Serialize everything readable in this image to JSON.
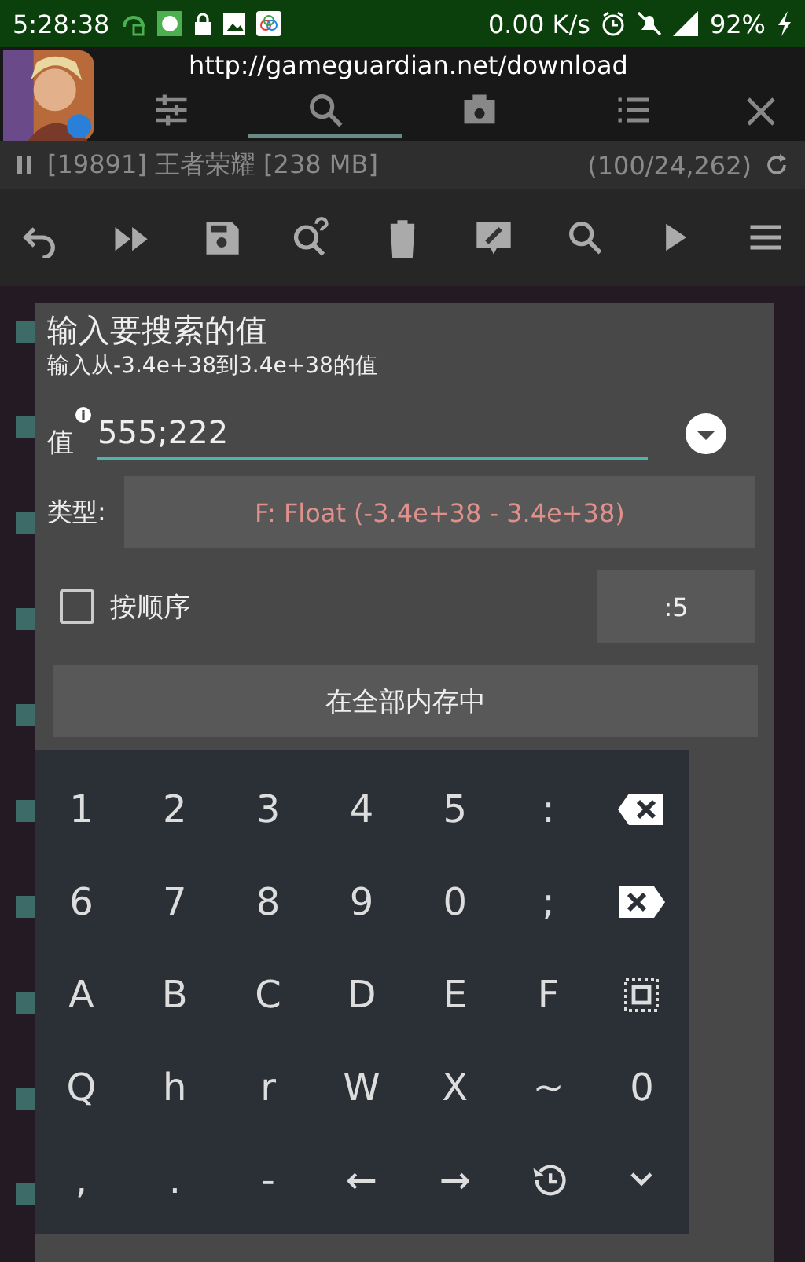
{
  "status_bar": {
    "time": "5:28:38",
    "speed": "0.00 K/s",
    "battery": "92%"
  },
  "overlay": {
    "url": "http://gameguardian.net/download",
    "tabs": [
      {
        "kind": "sliders",
        "selected": false
      },
      {
        "kind": "search",
        "selected": true
      },
      {
        "kind": "camera",
        "selected": false
      },
      {
        "kind": "list",
        "selected": false
      }
    ]
  },
  "background_page": {
    "checkboxes": [
      {
        "checked": true
      },
      {
        "checked": true
      },
      {
        "checked": true
      },
      {
        "checked": true
      },
      {
        "checked": true
      },
      {
        "checked": true
      },
      {
        "checked": true
      },
      {
        "checked": true
      },
      {
        "checked": true
      },
      {
        "checked": true
      }
    ]
  },
  "process": {
    "label": "[19891] 王者荣耀 [238 MB]",
    "count": "(100/24,262)"
  },
  "toolbar": [
    {
      "kind": "undo"
    },
    {
      "kind": "forward"
    },
    {
      "kind": "save"
    },
    {
      "kind": "search-unknown"
    },
    {
      "kind": "delete"
    },
    {
      "kind": "edit"
    },
    {
      "kind": "search"
    },
    {
      "kind": "play"
    },
    {
      "kind": "menu"
    }
  ],
  "dialog": {
    "title": "输入要搜索的值",
    "subtitle": "输入从-3.4e+38到3.4e+38的值",
    "value_label": "值",
    "value": "555;222",
    "type_label": "类型:",
    "type_value": "F: Float (-3.4e+38 - 3.4e+38)",
    "order_label": "按顺序",
    "order_checked": false,
    "order_value": ":5",
    "region_button": "在全部内存中"
  },
  "keyboard": [
    [
      {
        "kind": "char",
        "label": "1"
      },
      {
        "kind": "char",
        "label": "2"
      },
      {
        "kind": "char",
        "label": "3"
      },
      {
        "kind": "char",
        "label": "4"
      },
      {
        "kind": "char",
        "label": "5"
      },
      {
        "kind": "char",
        "label": ":"
      },
      {
        "kind": "backspace"
      }
    ],
    [
      {
        "kind": "char",
        "label": "6"
      },
      {
        "kind": "char",
        "label": "7"
      },
      {
        "kind": "char",
        "label": "8"
      },
      {
        "kind": "char",
        "label": "9"
      },
      {
        "kind": "char",
        "label": "0"
      },
      {
        "kind": "char",
        "label": ";"
      },
      {
        "kind": "clear"
      }
    ],
    [
      {
        "kind": "char",
        "label": "A"
      },
      {
        "kind": "char",
        "label": "B"
      },
      {
        "kind": "char",
        "label": "C"
      },
      {
        "kind": "char",
        "label": "D"
      },
      {
        "kind": "char",
        "label": "E"
      },
      {
        "kind": "char",
        "label": "F"
      },
      {
        "kind": "select"
      }
    ],
    [
      {
        "kind": "char",
        "label": "Q"
      },
      {
        "kind": "char",
        "label": "h"
      },
      {
        "kind": "char",
        "label": "r"
      },
      {
        "kind": "char",
        "label": "W"
      },
      {
        "kind": "char",
        "label": "X"
      },
      {
        "kind": "char",
        "label": "~"
      },
      {
        "kind": "char",
        "label": "0"
      }
    ],
    [
      {
        "kind": "char",
        "label": ","
      },
      {
        "kind": "char",
        "label": "."
      },
      {
        "kind": "char",
        "label": "-"
      },
      {
        "kind": "char",
        "label": "←"
      },
      {
        "kind": "char",
        "label": "→"
      },
      {
        "kind": "history"
      },
      {
        "kind": "collapse"
      }
    ]
  ]
}
